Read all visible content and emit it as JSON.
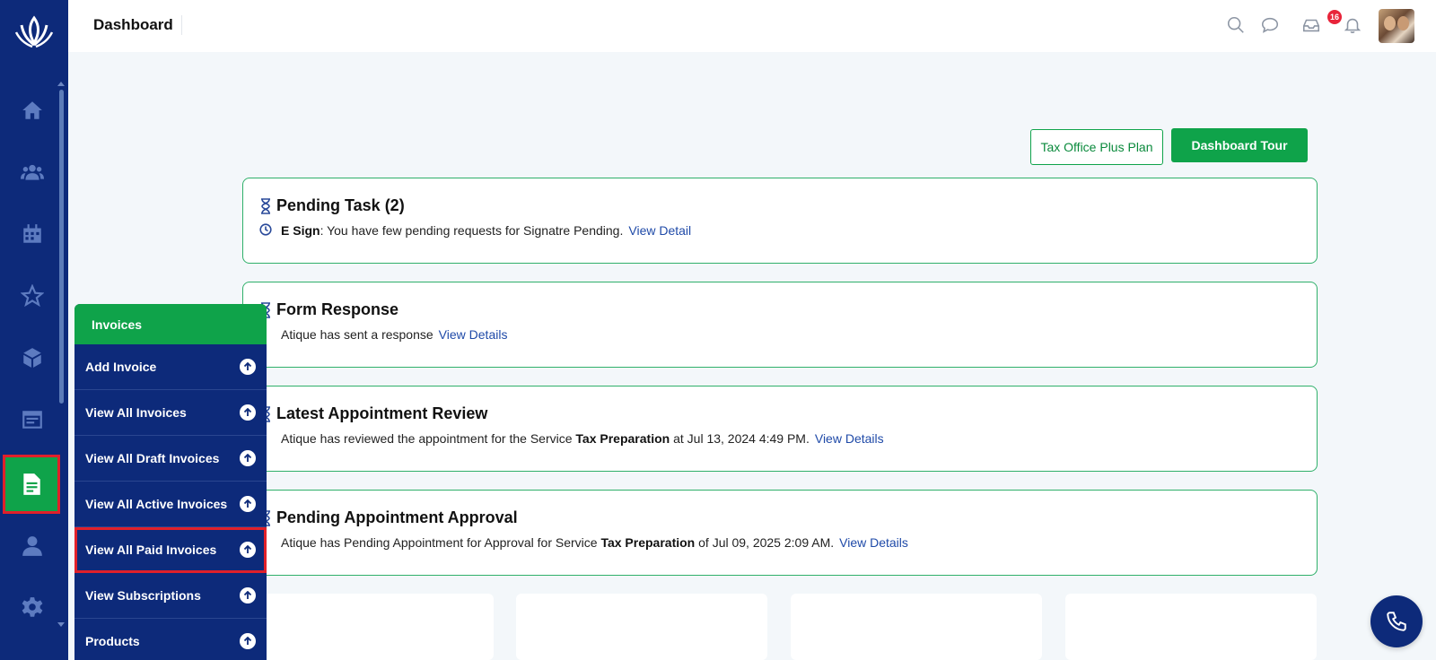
{
  "header": {
    "title": "Dashboard",
    "notification_count": "16"
  },
  "actions": {
    "plan_label": "Tax Office Plus Plan",
    "tour_label": "Dashboard Tour"
  },
  "cards": {
    "pending_task": {
      "title": "Pending Task (2)",
      "label": "E Sign",
      "text": ": You have few pending requests for Signatre Pending.",
      "link": "View Detail"
    },
    "form_response": {
      "title": "Form Response",
      "text": "Atique has sent a response",
      "link": "View Details"
    },
    "latest_review": {
      "title": "Latest Appointment Review",
      "text_before": "Atique has reviewed the appointment for the Service ",
      "service": "Tax Preparation",
      "text_after": " at Jul 13, 2024 4:49 PM.",
      "link": "View Details"
    },
    "pending_approval": {
      "title": "Pending Appointment Approval",
      "text_before": "Atique has Pending Appointment for Approval for Service ",
      "service": "Tax Preparation",
      "text_after": " of Jul 09, 2025 2:09 AM.",
      "link": "View Details"
    }
  },
  "submenu": {
    "header": "Invoices",
    "items": [
      {
        "label": "Add Invoice"
      },
      {
        "label": "View All Invoices"
      },
      {
        "label": "View All Draft Invoices"
      },
      {
        "label": "View All Active Invoices"
      },
      {
        "label": "View All Paid Invoices"
      },
      {
        "label": "View Subscriptions"
      },
      {
        "label": "Products"
      }
    ]
  },
  "sidebar": {
    "items": [
      "home-icon",
      "users-icon",
      "calendar-icon",
      "star-icon",
      "box-icon",
      "browser-icon",
      "invoice-icon",
      "user-icon",
      "gear-icon"
    ]
  },
  "colors": {
    "sidebar": "#0d2a7a",
    "accent": "#0fa34a",
    "highlight": "#e0202a",
    "link": "#1f4aa8"
  }
}
